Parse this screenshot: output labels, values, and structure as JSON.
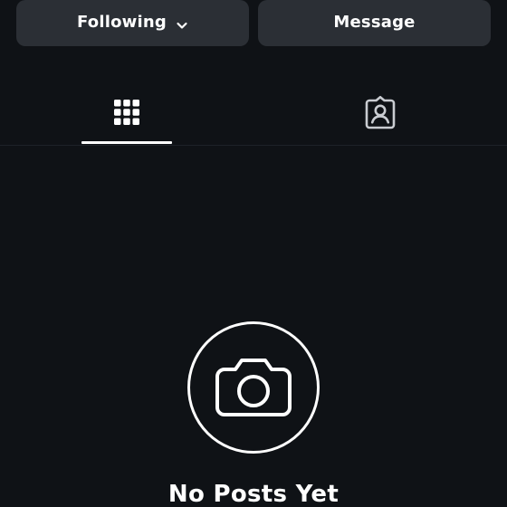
{
  "top_actions": {
    "following_label": "Following",
    "message_label": "Message"
  },
  "tabs": [
    {
      "name": "posts-grid",
      "icon": "grid-icon",
      "selected": true
    },
    {
      "name": "tagged",
      "icon": "tagged-user-icon",
      "selected": false
    }
  ],
  "empty_state": {
    "title": "No Posts Yet",
    "icon": "camera-icon"
  },
  "colors": {
    "background": "#0f1216",
    "button_background": "#2b2f35",
    "text": "#ffffff",
    "divider": "#1d2228",
    "inactive_icon": "#c9ccd1"
  }
}
